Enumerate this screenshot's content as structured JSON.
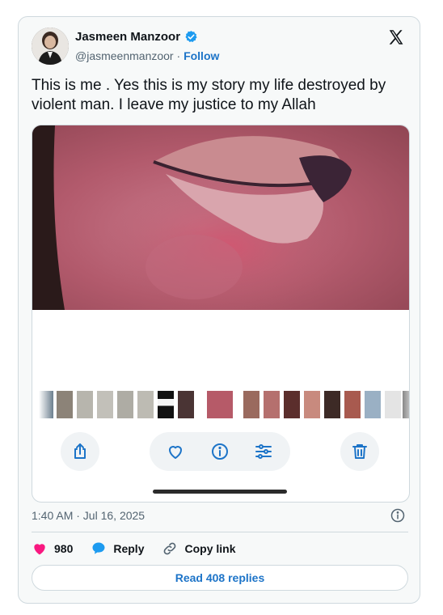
{
  "author": {
    "name": "Jasmeen Manzoor",
    "handle": "@jasmeenmanzoor",
    "separator": "·",
    "follow_label": "Follow",
    "verified": true
  },
  "platform_icon": "x-logo-icon",
  "tweet": {
    "text": "This is me . Yes this is my story my life destroyed by violent man. I leave my justice to my Allah"
  },
  "media": {
    "photo_icon": "photo-image",
    "thumbnail_count": 18,
    "actions": {
      "share_icon": "share-icon",
      "favorite_icon": "heart-icon",
      "info_icon": "info-icon",
      "adjust_icon": "sliders-icon",
      "delete_icon": "trash-icon"
    }
  },
  "timestamp": "1:40 AM · Jul 16, 2025",
  "stats": {
    "likes": "980",
    "reply_label": "Reply",
    "copy_link_label": "Copy link"
  },
  "read_replies_label": "Read 408 replies",
  "colors": {
    "accent": "#1d74c8",
    "like": "#f91880",
    "icon_blue": "#1d74c8",
    "border": "#cfd9de"
  }
}
